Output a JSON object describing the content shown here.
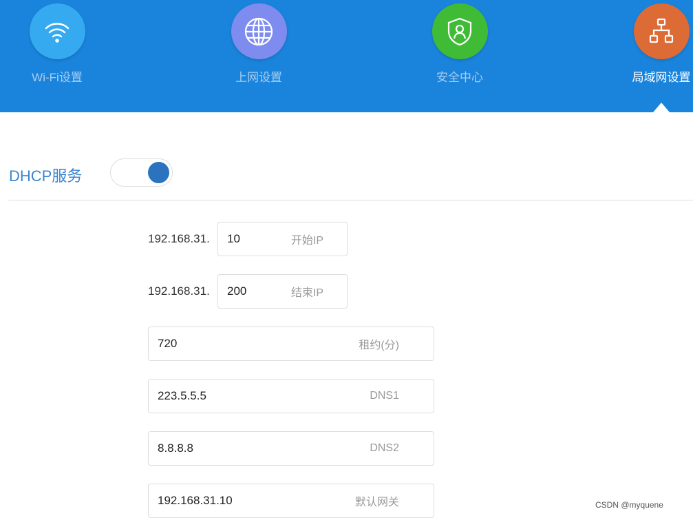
{
  "nav": [
    {
      "label": "Wi-Fi设置",
      "icon": "wifi-icon",
      "color": "#35aaf0"
    },
    {
      "label": "上网设置",
      "icon": "globe-icon",
      "color": "#7e8cf0"
    },
    {
      "label": "安全中心",
      "icon": "shield-user-icon",
      "color": "#3fbb36"
    },
    {
      "label": "局域网设置",
      "icon": "network-icon",
      "color": "#dd6b35",
      "active": true
    }
  ],
  "dhcp": {
    "title": "DHCP服务",
    "enabled": true
  },
  "fields": {
    "start": {
      "prefix": "192.168.31.",
      "value": "10",
      "hint": "开始IP"
    },
    "end": {
      "prefix": "192.168.31.",
      "value": "200",
      "hint": "结束IP"
    },
    "lease": {
      "value": "720",
      "hint": "租约(分)"
    },
    "dns1": {
      "value": "223.5.5.5",
      "hint": "DNS1"
    },
    "dns2": {
      "value": "8.8.8.8",
      "hint": "DNS2"
    },
    "gateway": {
      "value": "192.168.31.10",
      "hint": "默认网关"
    }
  },
  "watermark": "CSDN @myquene"
}
